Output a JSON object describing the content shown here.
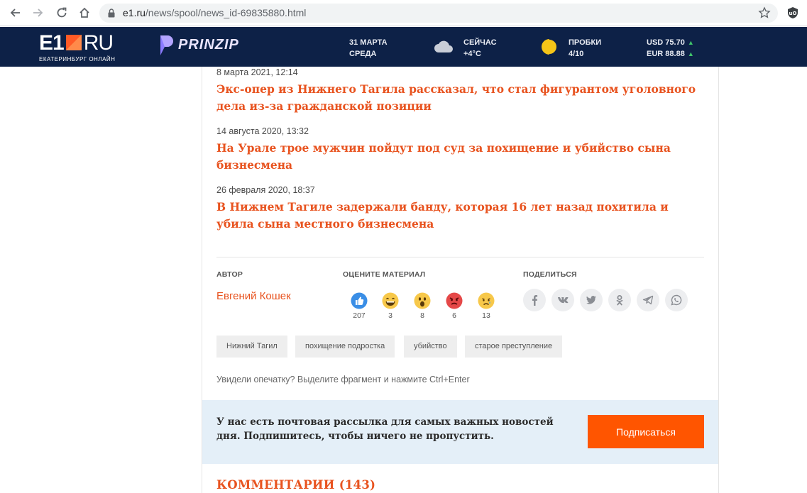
{
  "browser": {
    "url_host": "e1.ru",
    "url_path": "/news/spool/news_id-69835880.html"
  },
  "header": {
    "logo_text": "E1",
    "logo_ru": "RU",
    "logo_subtitle": "ЕКАТЕРИНБУРГ ОНЛАЙН",
    "partner": "PRINZIP",
    "date_line1": "31 МАРТА",
    "date_line2": "СРЕДА",
    "weather_label": "СЕЙЧАС",
    "weather_value": "+4°C",
    "traffic_label": "ПРОБКИ",
    "traffic_value": "4/10",
    "usd": "USD 75.70",
    "eur": "EUR 88.88",
    "colors": {
      "bg": "#0d2147",
      "accent": "#ff5a26",
      "up": "#3fc46b"
    }
  },
  "related": [
    {
      "date": "8 марта 2021, 12:14",
      "title": "Экс-опер из Нижнего Тагила рассказал, что стал фигурантом уголовного дела из-за гражданской позиции"
    },
    {
      "date": "14 августа 2020, 13:32",
      "title": "На Урале трое мужчин пойдут под суд за похищение и убийство сына бизнесмена"
    },
    {
      "date": "26 февраля 2020, 18:37",
      "title": "В Нижнем Тагиле задержали банду, которая 16 лет назад похитила и убила сына местного бизнесмена"
    }
  ],
  "meta": {
    "author_label": "АВТОР",
    "author_name": "Евгений Кошек",
    "rate_label": "ОЦЕНИТЕ МАТЕРИАЛ",
    "share_label": "ПОДЕЛИТЬСЯ",
    "reactions": [
      {
        "icon": "like-icon",
        "count": "207"
      },
      {
        "icon": "laugh-icon",
        "count": "3"
      },
      {
        "icon": "wow-icon",
        "count": "8"
      },
      {
        "icon": "angry-icon",
        "count": "6"
      },
      {
        "icon": "sad-icon",
        "count": "13"
      }
    ],
    "share_icons": [
      "facebook-icon",
      "vk-icon",
      "twitter-icon",
      "odnoklassniki-icon",
      "telegram-icon",
      "whatsapp-icon"
    ]
  },
  "tags": [
    "Нижний Тагил",
    "похищение подростка",
    "убийство",
    "старое преступление"
  ],
  "typo_note": "Увидели опечатку? Выделите фрагмент и нажмите Ctrl+Enter",
  "newsletter": {
    "text": "У нас есть почтовая рассылка для самых важных новостей дня. Подпишитесь, чтобы ничего не пропустить.",
    "button": "Подписаться"
  },
  "comments_heading": "КОММЕНТАРИИ (143)",
  "colors": {
    "accent": "#e8531f",
    "button": "#ff5500",
    "newsletter_bg": "#e4eff8"
  }
}
